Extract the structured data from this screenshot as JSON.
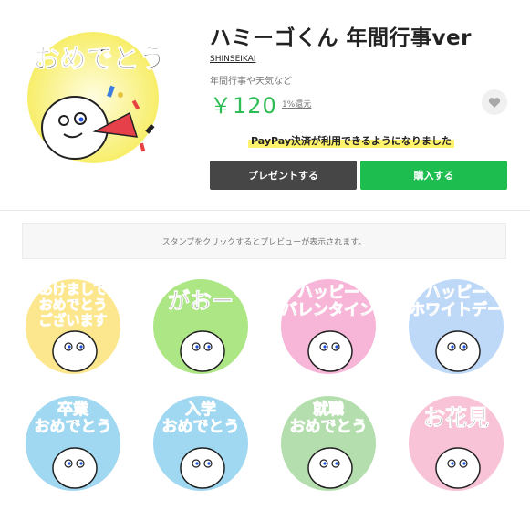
{
  "product": {
    "title": "ハミーゴくん 年間行事ver",
    "author": "SHINSEIKAI",
    "description": "年間行事や天気など",
    "price": "￥120",
    "rebate": "1%還元",
    "main_art_text": "おめでとう"
  },
  "promo": {
    "paypay_text": "PayPay決済が利用できるようになりました"
  },
  "actions": {
    "gift_label": "プレゼントする",
    "buy_label": "購入する"
  },
  "preview_notice": "スタンプをクリックするとプレビューが表示されます。",
  "stickers": [
    {
      "lines": [
        "あけまして",
        "おめでとう",
        "ございます"
      ],
      "bg": "#fbe37a"
    },
    {
      "lines": [
        "がおー"
      ],
      "bg": "#9fe26f"
    },
    {
      "lines": [
        "ハッピー",
        "バレンタイン"
      ],
      "bg": "#f6a9d0"
    },
    {
      "lines": [
        "ハッピー",
        "ホワイトデー"
      ],
      "bg": "#b3d1f7"
    },
    {
      "lines": [
        "卒業",
        "おめでとう"
      ],
      "bg": "#8fd0ee"
    },
    {
      "lines": [
        "入学",
        "おめでとう"
      ],
      "bg": "#8fd0ee"
    },
    {
      "lines": [
        "就職",
        "おめでとう"
      ],
      "bg": "#a8d8a0"
    },
    {
      "lines": [
        "お花見"
      ],
      "bg": "#f7b9cf"
    }
  ],
  "colors": {
    "price": "#2ebd55",
    "buy_button": "#1ebd4f",
    "gift_button": "#464646",
    "highlight": "#fff36b"
  }
}
